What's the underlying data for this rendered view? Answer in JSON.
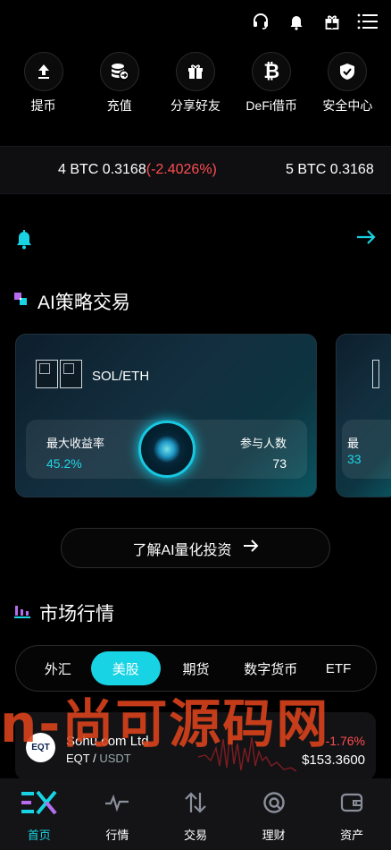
{
  "topbar": {
    "icons": [
      "headset-icon",
      "bell-icon",
      "gift-icon",
      "menu-icon"
    ]
  },
  "quick_actions": [
    {
      "label": "提币",
      "icon": "withdraw-icon"
    },
    {
      "label": "充值",
      "icon": "deposit-icon"
    },
    {
      "label": "分享好友",
      "icon": "gift-icon"
    },
    {
      "label": "DeFi借币",
      "icon": "bitcoin-icon"
    },
    {
      "label": "安全中心",
      "icon": "shield-icon"
    }
  ],
  "ticker": {
    "item1": {
      "text": "4 BTC 0.3168",
      "change": "(-2.4026%)"
    },
    "item2": {
      "text": "5 BTC 0.3168"
    }
  },
  "ai_section": {
    "title": "AI策略交易",
    "card": {
      "pair": "SOL/ETH",
      "max_yield_label": "最大收益率",
      "max_yield_value": "45.2%",
      "participants_label": "参与人数",
      "participants_value": "73"
    },
    "peek_card": {
      "label_fragment": "最",
      "value_fragment": "33"
    },
    "learn_button": "了解AI量化投资"
  },
  "market_section": {
    "title": "市场行情",
    "tabs": [
      "外汇",
      "美股",
      "期货",
      "数字货币",
      "ETF"
    ],
    "active_tab": "美股",
    "rows": [
      {
        "logo": "EQT",
        "name": "Sohu.com Ltd",
        "symbol": "EQT",
        "quote": "USDT",
        "change": "-1.76%",
        "price": "$153.3600"
      }
    ]
  },
  "watermark": "n-尚可源码网",
  "bottom_nav": [
    {
      "label": "首页",
      "icon": "home-icon",
      "active": true
    },
    {
      "label": "行情",
      "icon": "pulse-icon",
      "active": false
    },
    {
      "label": "交易",
      "icon": "swap-icon",
      "active": false
    },
    {
      "label": "理财",
      "icon": "finance-icon",
      "active": false
    },
    {
      "label": "资产",
      "icon": "wallet-icon",
      "active": false
    }
  ],
  "colors": {
    "accent": "#18d3e3",
    "negative": "#ff4d4f",
    "background": "#000000"
  }
}
